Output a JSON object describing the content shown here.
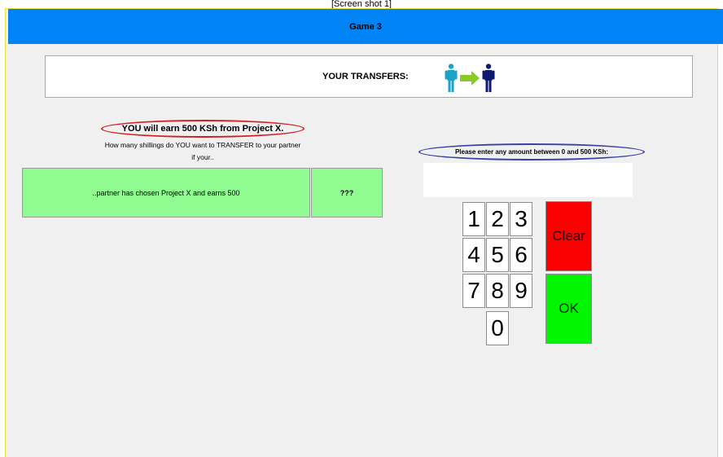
{
  "window": {
    "caption": "[Screen shot 1]"
  },
  "titlebar": {
    "title": "Game 3"
  },
  "transfers": {
    "label": "YOUR TRANSFERS:",
    "icon": "person-to-person-transfer-icon"
  },
  "left": {
    "earn_text": "YOU will earn 500 KSh from Project X.",
    "question_line1": "How many shillings do YOU want to TRANSFER to your partner",
    "question_line2": "if your..",
    "scenario_text": "..partner has chosen Project X and earns 500",
    "answer_text": "???"
  },
  "right": {
    "prompt": "Please enter any amount between 0 and 500 KSh:",
    "amount_value": "",
    "keys": [
      "1",
      "2",
      "3",
      "4",
      "5",
      "6",
      "7",
      "8",
      "9",
      "0"
    ],
    "clear_label": "Clear",
    "ok_label": "OK"
  },
  "colors": {
    "titlebar": "#0084f5",
    "cell_green": "#90fb90",
    "clear_red": "#fb0000",
    "ok_green": "#00f500",
    "oval_red": "#d21f24",
    "oval_blue": "#3b3fa6",
    "arrow_green": "#8ac926"
  }
}
